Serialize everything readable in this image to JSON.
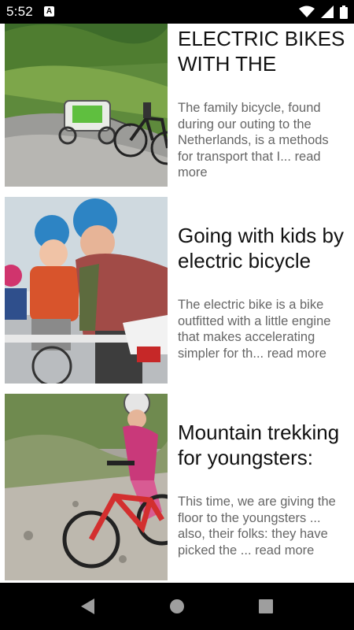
{
  "status_bar": {
    "time": "5:52",
    "notification_icon_letter": "A",
    "icons": [
      "wifi-icon",
      "signal-icon",
      "battery-icon"
    ]
  },
  "articles": [
    {
      "title": "ELECTRIC BIKES WITH THE",
      "excerpt": "The family bicycle, found during our outing to the Netherlands, is a methods for transport that I... read more",
      "image": "bike-with-child-trailer"
    },
    {
      "title": "Going with kids by electric bicycle",
      "excerpt": "The electric bike is a bike outfitted with a little engine that makes accelerating simpler for th... read more",
      "image": "father-and-kids-on-cargo-bike"
    },
    {
      "title": "Mountain trekking for youngsters:",
      "excerpt": "This time, we are giving the floor to the youngsters ... also, their folks: they have picked the ... read more",
      "image": "girl-on-mountain-bike"
    }
  ],
  "nav_bar": {
    "buttons": [
      "back-icon",
      "home-icon",
      "recents-icon"
    ]
  },
  "colors": {
    "status_bar_bg": "#000000",
    "nav_bar_bg": "#000000",
    "title_text": "#111111",
    "excerpt_text": "#666666"
  }
}
